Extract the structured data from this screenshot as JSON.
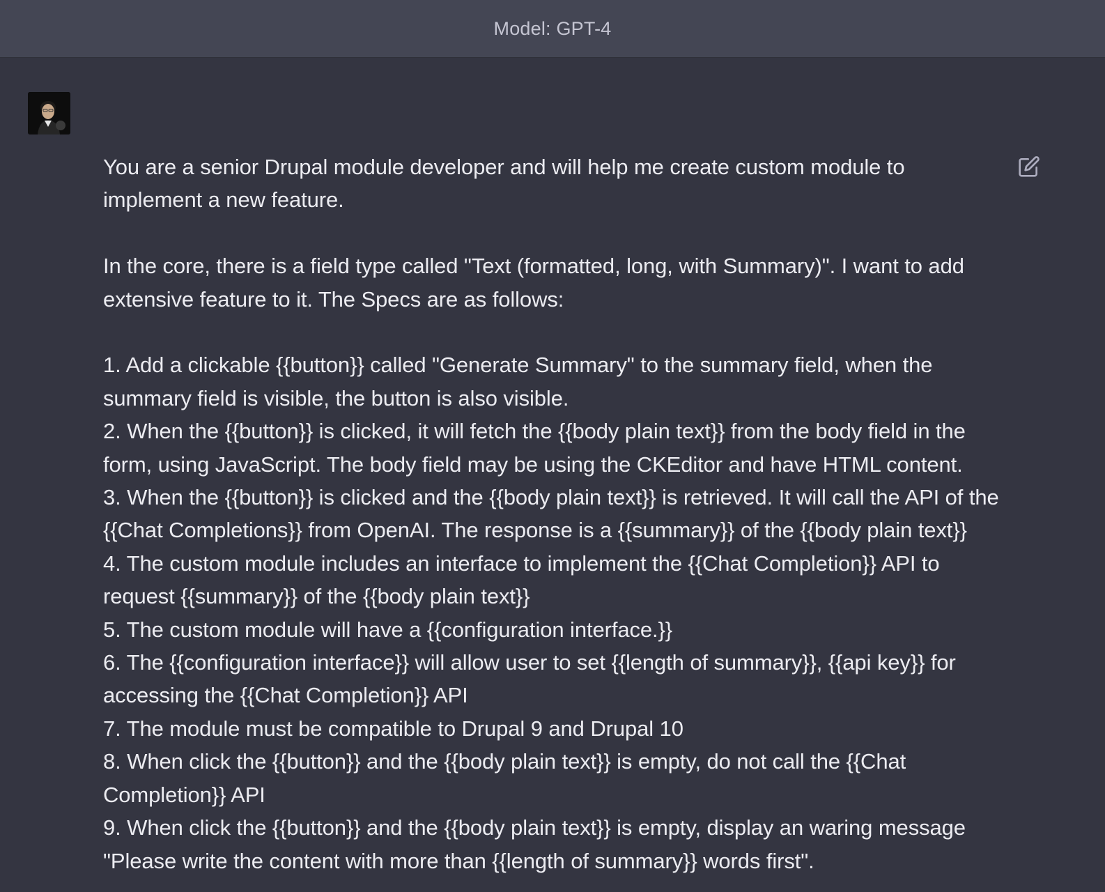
{
  "header": {
    "model_label": "Model: GPT-4"
  },
  "message": {
    "role": "user",
    "avatar_icon": "user-avatar-photo",
    "edit_icon": "edit-icon",
    "paragraphs": [
      "You are a senior Drupal module developer and will help me create custom module to implement a new feature.",
      "In the core, there is a field type called \"Text (formatted, long, with Summary)\". I want to add extensive feature to it. The Specs are as follows:",
      "1. Add a clickable {{button}} called \"Generate Summary\" to the summary field, when the summary field is visible, the button is also visible.\n2. When the {{button}} is clicked, it will fetch the {{body plain text}} from the body field in the form, using JavaScript. The body field may be using the CKEditor and have HTML content.\n3. When the {{button}} is clicked and the {{body plain text}} is retrieved. It will call the API of the {{Chat Completions}} from OpenAI. The response is a {{summary}} of the {{body plain text}}\n4. The custom module includes an interface to implement the {{Chat Completion}} API to request {{summary}} of the {{body plain text}}\n5. The custom module will have a {{configuration interface.}}\n6. The {{configuration interface}} will allow user to set {{length of summary}}, {{api key}} for accessing the {{Chat Completion}} API\n7. The module must be compatible to Drupal 9 and Drupal 10\n8. When click the {{button}} and the {{body plain text}} is empty, do not call the {{Chat Completion}} API\n9. When click the {{button}} and the {{body plain text}} is empty, display an waring message \"Please write the content with more than {{length of summary}} words first\"."
    ]
  },
  "colors": {
    "background": "#343541",
    "header_background": "#444654",
    "text": "#ececf1",
    "muted_text": "#c5c5d2"
  }
}
